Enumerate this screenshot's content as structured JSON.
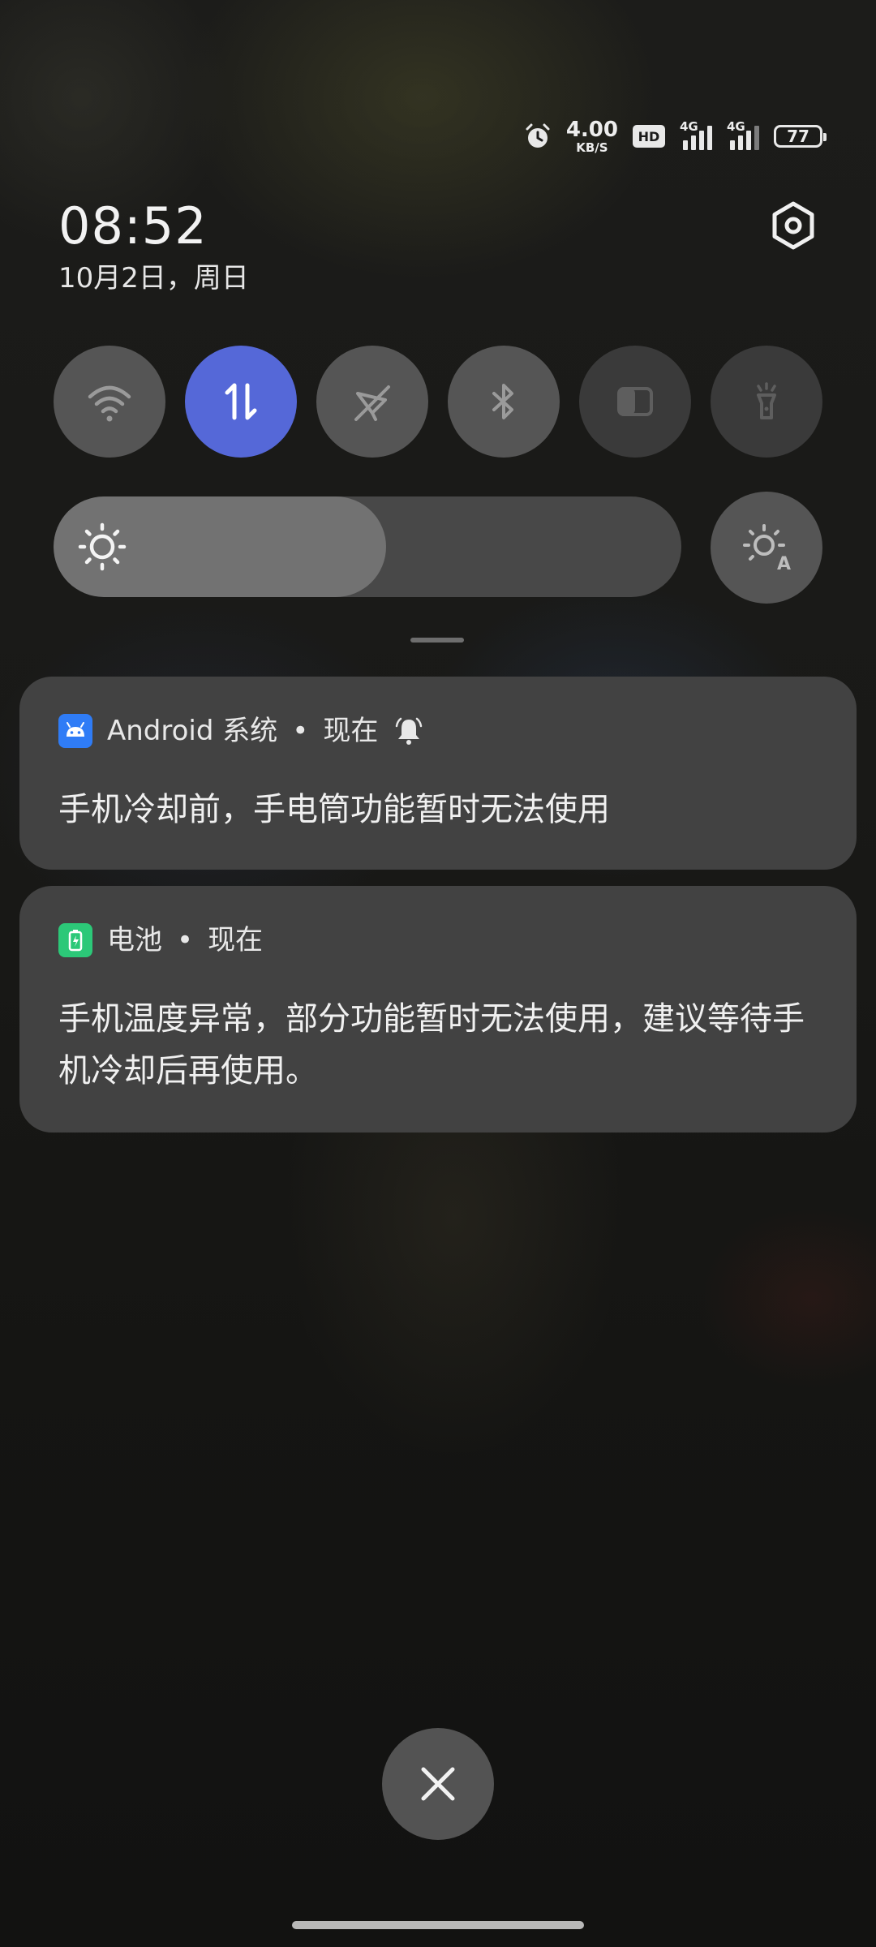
{
  "status_bar": {
    "net_speed_value": "4.00",
    "net_speed_unit": "KB/S",
    "hd_badge": "HD",
    "sim1_network": "4G",
    "sim2_network": "4G",
    "battery_level": "77",
    "icons": [
      "alarm-icon",
      "hd-icon",
      "signal-icon",
      "battery-icon"
    ]
  },
  "header": {
    "time": "08:52",
    "date": "10月2日，周日",
    "settings_icon": "settings-hex-icon"
  },
  "quick_toggles": [
    {
      "name": "wifi",
      "icon": "wifi-icon",
      "state": "off"
    },
    {
      "name": "mobile-data",
      "icon": "data-arrows-icon",
      "state": "on"
    },
    {
      "name": "airplane-mode",
      "icon": "airplane-off-icon",
      "state": "off"
    },
    {
      "name": "bluetooth",
      "icon": "bluetooth-icon",
      "state": "off"
    },
    {
      "name": "screen-mode",
      "icon": "half-screen-icon",
      "state": "disabled"
    },
    {
      "name": "flashlight",
      "icon": "flashlight-icon",
      "state": "disabled"
    }
  ],
  "brightness": {
    "level_percent": 53,
    "auto_icon": "auto-brightness-icon"
  },
  "notifications": [
    {
      "app": "Android 系统",
      "separator": "•",
      "time": "现在",
      "icon": "android-icon",
      "has_bell": true,
      "body": "手机冷却前，手电筒功能暂时无法使用"
    },
    {
      "app": "电池",
      "separator": "•",
      "time": "现在",
      "icon": "battery-app-icon",
      "has_bell": false,
      "body": "手机温度异常，部分功能暂时无法使用，建议等待手机冷却后再使用。"
    }
  ],
  "colors": {
    "accent": "#5568d8",
    "android_icon": "#2f7cf6",
    "battery_app_icon": "#2cc878",
    "card_bg": "#424242"
  }
}
